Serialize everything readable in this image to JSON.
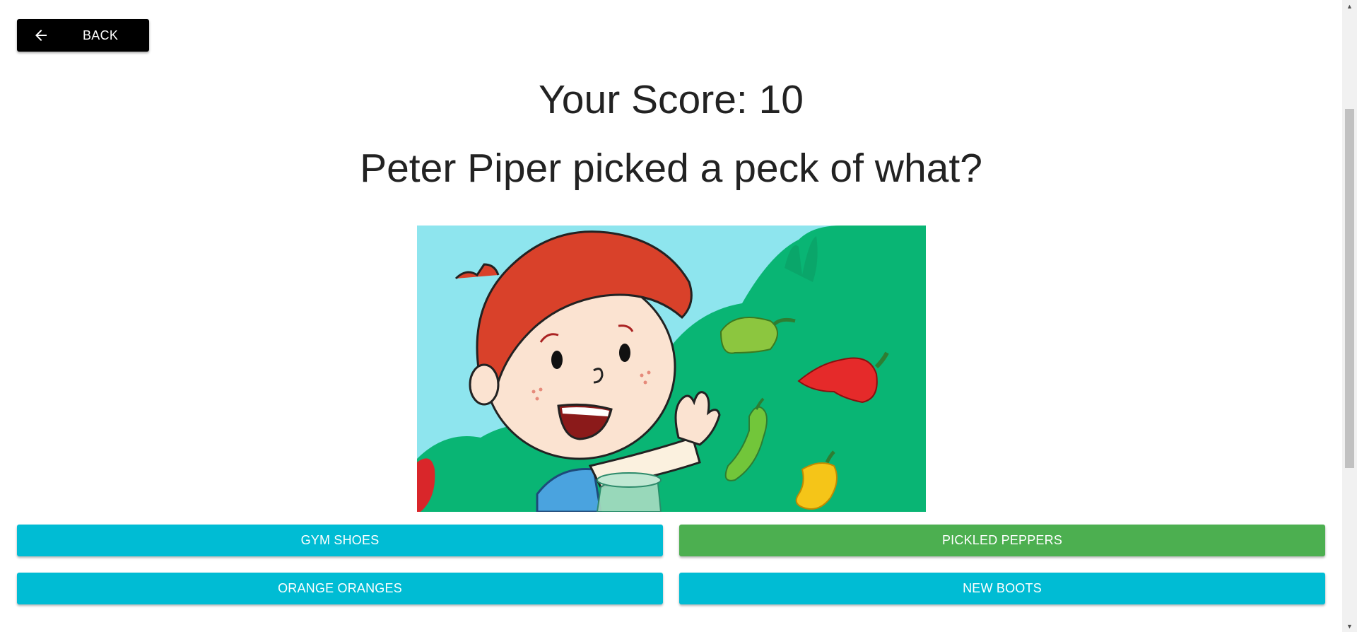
{
  "back_button": {
    "label": "BACK"
  },
  "score": {
    "text": "Your Score: 10"
  },
  "question": {
    "text": "Peter Piper picked a peck of what?"
  },
  "answers": [
    {
      "label": "GYM SHOES",
      "color": "#00bcd4"
    },
    {
      "label": "PICKLED PEPPERS",
      "color": "#4caf50"
    },
    {
      "label": "ORANGE ORANGES",
      "color": "#00bcd4"
    },
    {
      "label": "NEW BOOTS",
      "color": "#00bcd4"
    }
  ],
  "colors": {
    "answer_default": "#00bcd4",
    "answer_correct": "#4caf50",
    "back_button_bg": "#000000"
  },
  "icons": {
    "back": "arrow-left-icon",
    "scroll_up": "triangle-up-icon",
    "scroll_down": "triangle-down-icon"
  }
}
